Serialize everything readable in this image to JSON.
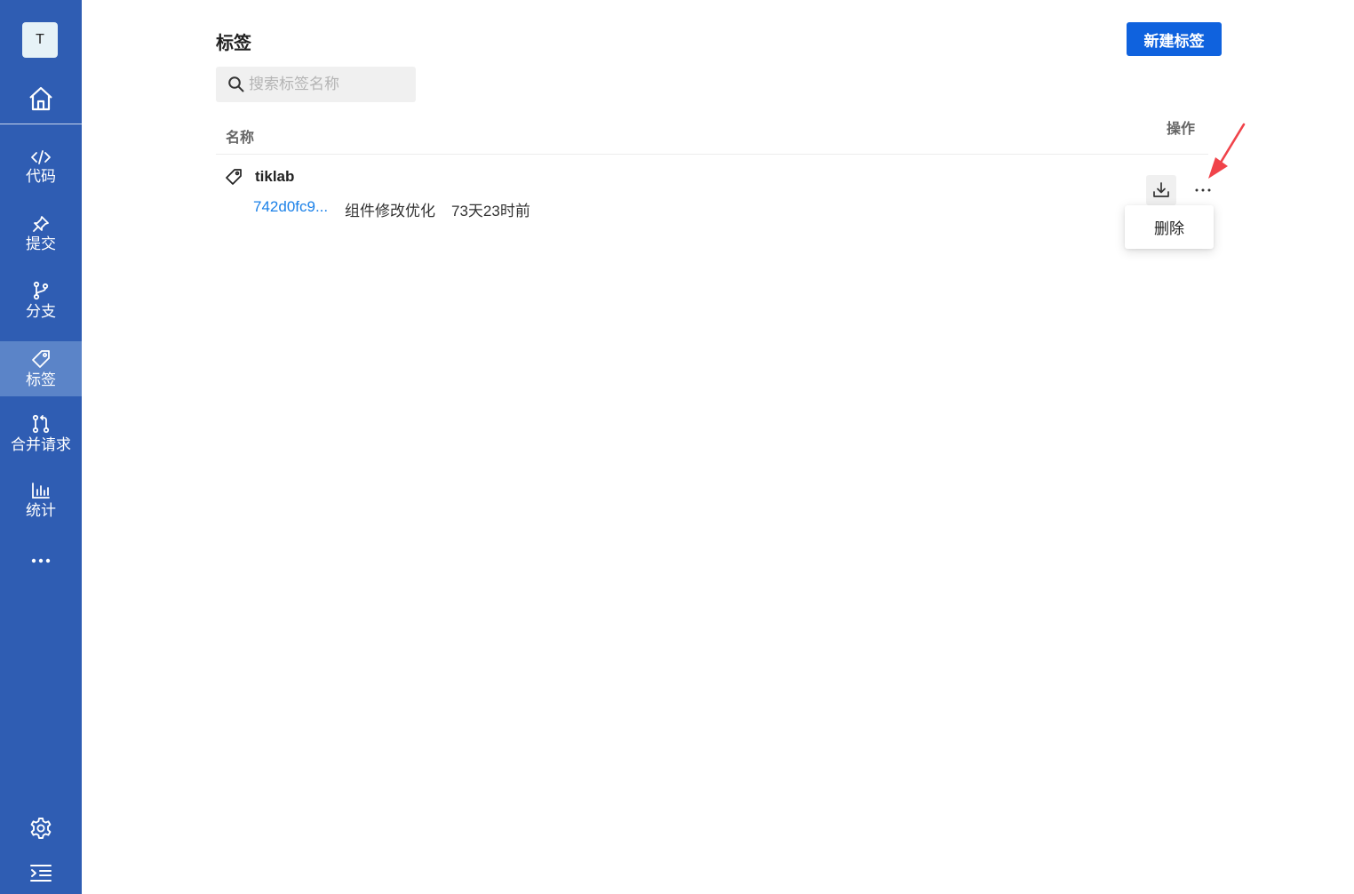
{
  "sidebar": {
    "avatar_letter": "T",
    "items": [
      {
        "label": "代码",
        "icon": "code-icon"
      },
      {
        "label": "提交",
        "icon": "pin-icon"
      },
      {
        "label": "分支",
        "icon": "branch-icon"
      },
      {
        "label": "标签",
        "icon": "tag-icon",
        "active": true
      },
      {
        "label": "合并请求",
        "icon": "merge-request-icon"
      },
      {
        "label": "统计",
        "icon": "chart-icon"
      }
    ],
    "more_label": "•••"
  },
  "header": {
    "title": "标签",
    "new_button_label": "新建标签"
  },
  "search": {
    "placeholder": "搜索标签名称",
    "value": ""
  },
  "table": {
    "columns": {
      "name": "名称",
      "actions": "操作"
    },
    "rows": [
      {
        "name": "tiklab",
        "commit_hash": "742d0fc9...",
        "commit_message": "组件修改优化",
        "commit_time": "73天23时前"
      }
    ]
  },
  "menu": {
    "items": [
      {
        "label": "删除"
      }
    ]
  },
  "colors": {
    "sidebar_bg": "#2f5db3",
    "sidebar_active_bg": "#5b84c8",
    "primary_button": "#0f62de",
    "link": "#1a80e8",
    "annotation_arrow": "#f0434a"
  }
}
